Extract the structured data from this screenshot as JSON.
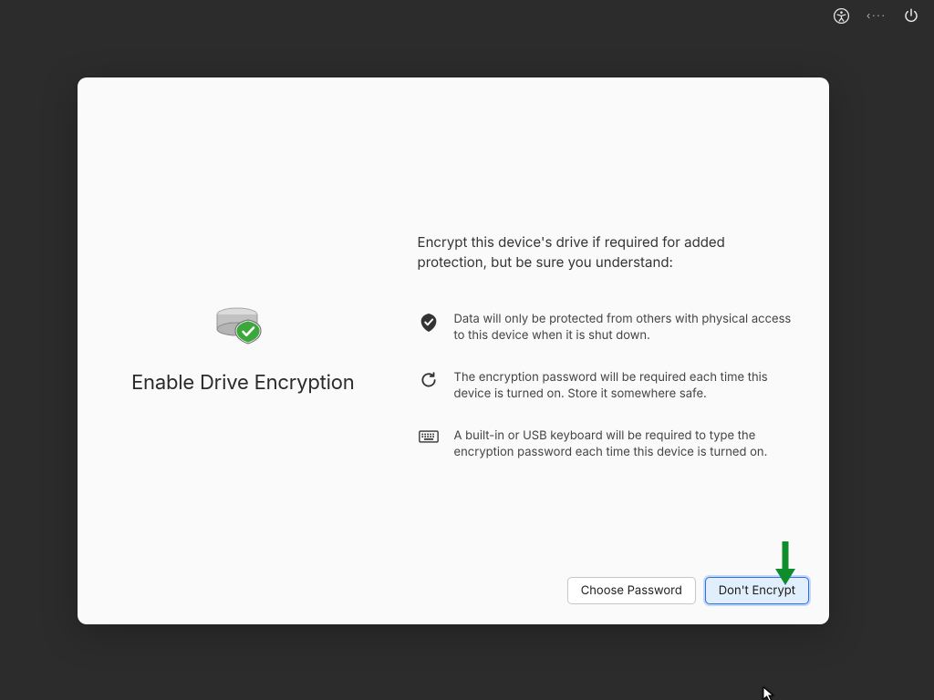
{
  "topbar": {
    "accessibility": "accessibility",
    "network": "network",
    "power": "power"
  },
  "left": {
    "title": "Enable Drive Encryption"
  },
  "intro": "Encrypt this device's drive if required for added protection, but be sure you understand:",
  "points": {
    "shield": "Data will only be protected from others with physical access to this device when it is shut down.",
    "restart": "The encryption password will be required each time this device is turned on. Store it somewhere safe.",
    "keyboard": "A built-in or USB keyboard will be required to type the encryption password each time this device is turned on."
  },
  "buttons": {
    "choose": "Choose Password",
    "skip": "Don't Encrypt"
  }
}
